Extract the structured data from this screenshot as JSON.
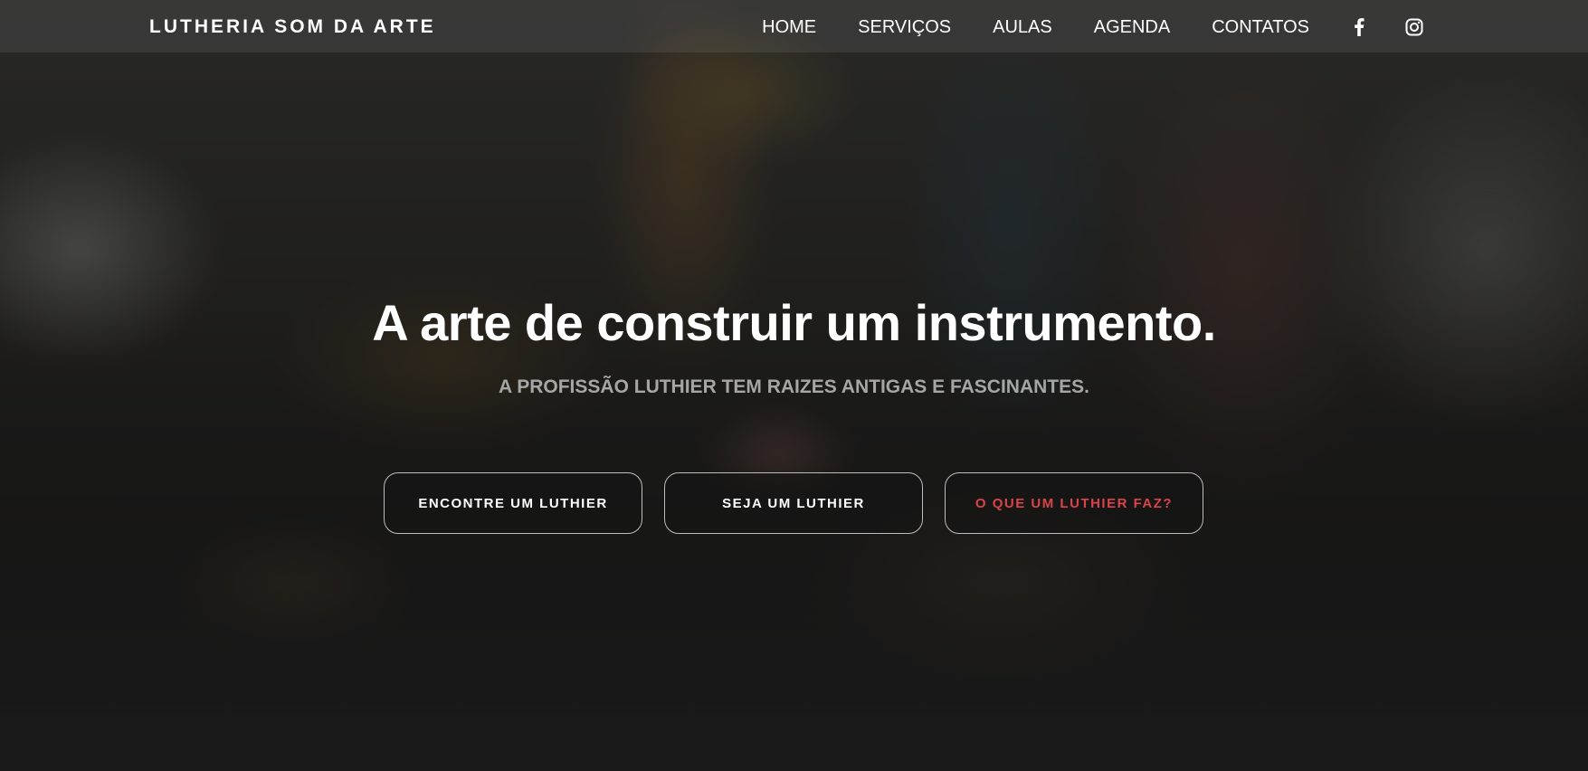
{
  "brand": {
    "name": "LUTHERIA SOM DA ARTE"
  },
  "nav": {
    "items": [
      {
        "label": "HOME"
      },
      {
        "label": "SERVIÇOS"
      },
      {
        "label": "AULAS"
      },
      {
        "label": "AGENDA"
      },
      {
        "label": "CONTATOS"
      }
    ],
    "social": [
      {
        "icon": "facebook-icon"
      },
      {
        "icon": "instagram-icon"
      }
    ]
  },
  "hero": {
    "title": "A arte de construir um instrumento.",
    "subtitle": "A PROFISSÃO LUTHIER TEM RAIZES ANTIGAS E FASCINANTES.",
    "buttons": [
      {
        "label": "ENCONTRE UM LUTHIER"
      },
      {
        "label": "SEJA UM LUTHIER"
      },
      {
        "label": "O QUE UM LUTHIER FAZ?"
      }
    ]
  },
  "colors": {
    "accent_red": "#d9434a",
    "text_white": "#ffffff",
    "subtitle_gray": "#a6a6a6",
    "button_border": "#bdbdbd"
  }
}
